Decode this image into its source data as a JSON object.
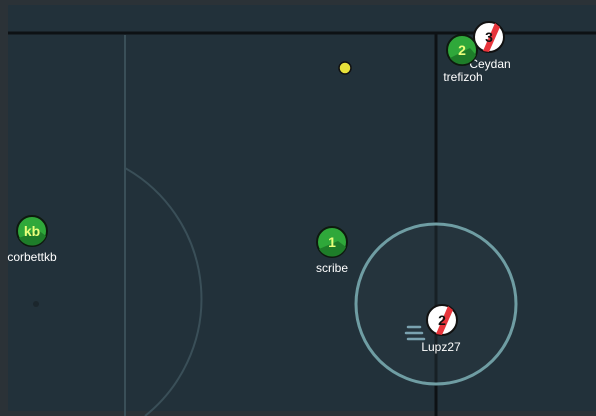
{
  "colors": {
    "outer_bg": "#2b3237",
    "pitch_bg": "#22313a",
    "line_dark": "#0d1114",
    "line_light": "#3a4f58",
    "ring": "#6f9da3",
    "ball": "#e7e13a",
    "red_team": "#e7343b",
    "green_team": "#2fa83a"
  },
  "ball": {
    "icon": "ball-icon"
  },
  "players": [
    {
      "id": "p-ceydan",
      "name": "Ceydan",
      "avatar": "3",
      "team": "red"
    },
    {
      "id": "p-trefizoh",
      "name": "trefizoh",
      "avatar": "2",
      "team": "green"
    },
    {
      "id": "p-corbettkb",
      "name": "corbettkb",
      "avatar": "kb",
      "team": "green"
    },
    {
      "id": "p-scribe",
      "name": "scribe",
      "avatar": "1",
      "team": "green"
    },
    {
      "id": "p-lupz27",
      "name": "Lupz27",
      "avatar": "2",
      "team": "red",
      "controlled": true
    }
  ],
  "indicator": {
    "icon": "speed-lines-icon"
  }
}
